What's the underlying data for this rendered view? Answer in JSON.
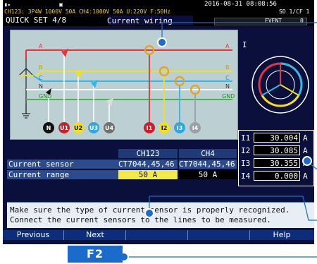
{
  "status": {
    "left_text": "CH123: 3P4W 1000V 50A CH4:1000V 50A U:220V F:50Hz",
    "datetime": "2016-08-31 08:08:56",
    "right_text": "SD 1/CF 1"
  },
  "header": {
    "page": "QUICK SET 4/8",
    "title": "Current wiring",
    "event": "EVENT",
    "event_count": "0"
  },
  "diagram": {
    "wires": [
      "A",
      "B",
      "C",
      "N",
      "GND"
    ],
    "wires_right": [
      "A",
      "B",
      "C",
      "N",
      "GND"
    ],
    "terminals": [
      "N",
      "U1",
      "U2",
      "U3",
      "U4",
      "I1",
      "I2",
      "I3",
      "I4"
    ],
    "colors": {
      "A": "#e8323c",
      "B": "#f0e020",
      "C": "#2fb8e8",
      "N": "#ffffff",
      "GND": "#45b848",
      "I4": "#9aa0a8"
    }
  },
  "phasor": {
    "label": "I"
  },
  "readings": [
    {
      "label": "I1",
      "value": "30.004",
      "unit": "A"
    },
    {
      "label": "I2",
      "value": "30.085",
      "unit": "A"
    },
    {
      "label": "I3",
      "value": "30.355",
      "unit": "A"
    },
    {
      "label": "I4",
      "value": "0.000",
      "unit": "A"
    }
  ],
  "table": {
    "col_ch123": "CH123",
    "col_ch4": "CH4",
    "rows": [
      {
        "label": "Current sensor",
        "ch123": "CT7044,45,46",
        "ch4": "CT7044,45,46"
      },
      {
        "label": "Current range",
        "ch123": "50 A",
        "ch4": "50 A"
      }
    ]
  },
  "message": {
    "line1": "Make sure the type of current sensor is properly recognized.",
    "line2": "Connect the current sensors to the lines to be measured."
  },
  "fn_buttons": [
    "Previous",
    "Next",
    "",
    "",
    "Help"
  ],
  "f2_key": "F2"
}
